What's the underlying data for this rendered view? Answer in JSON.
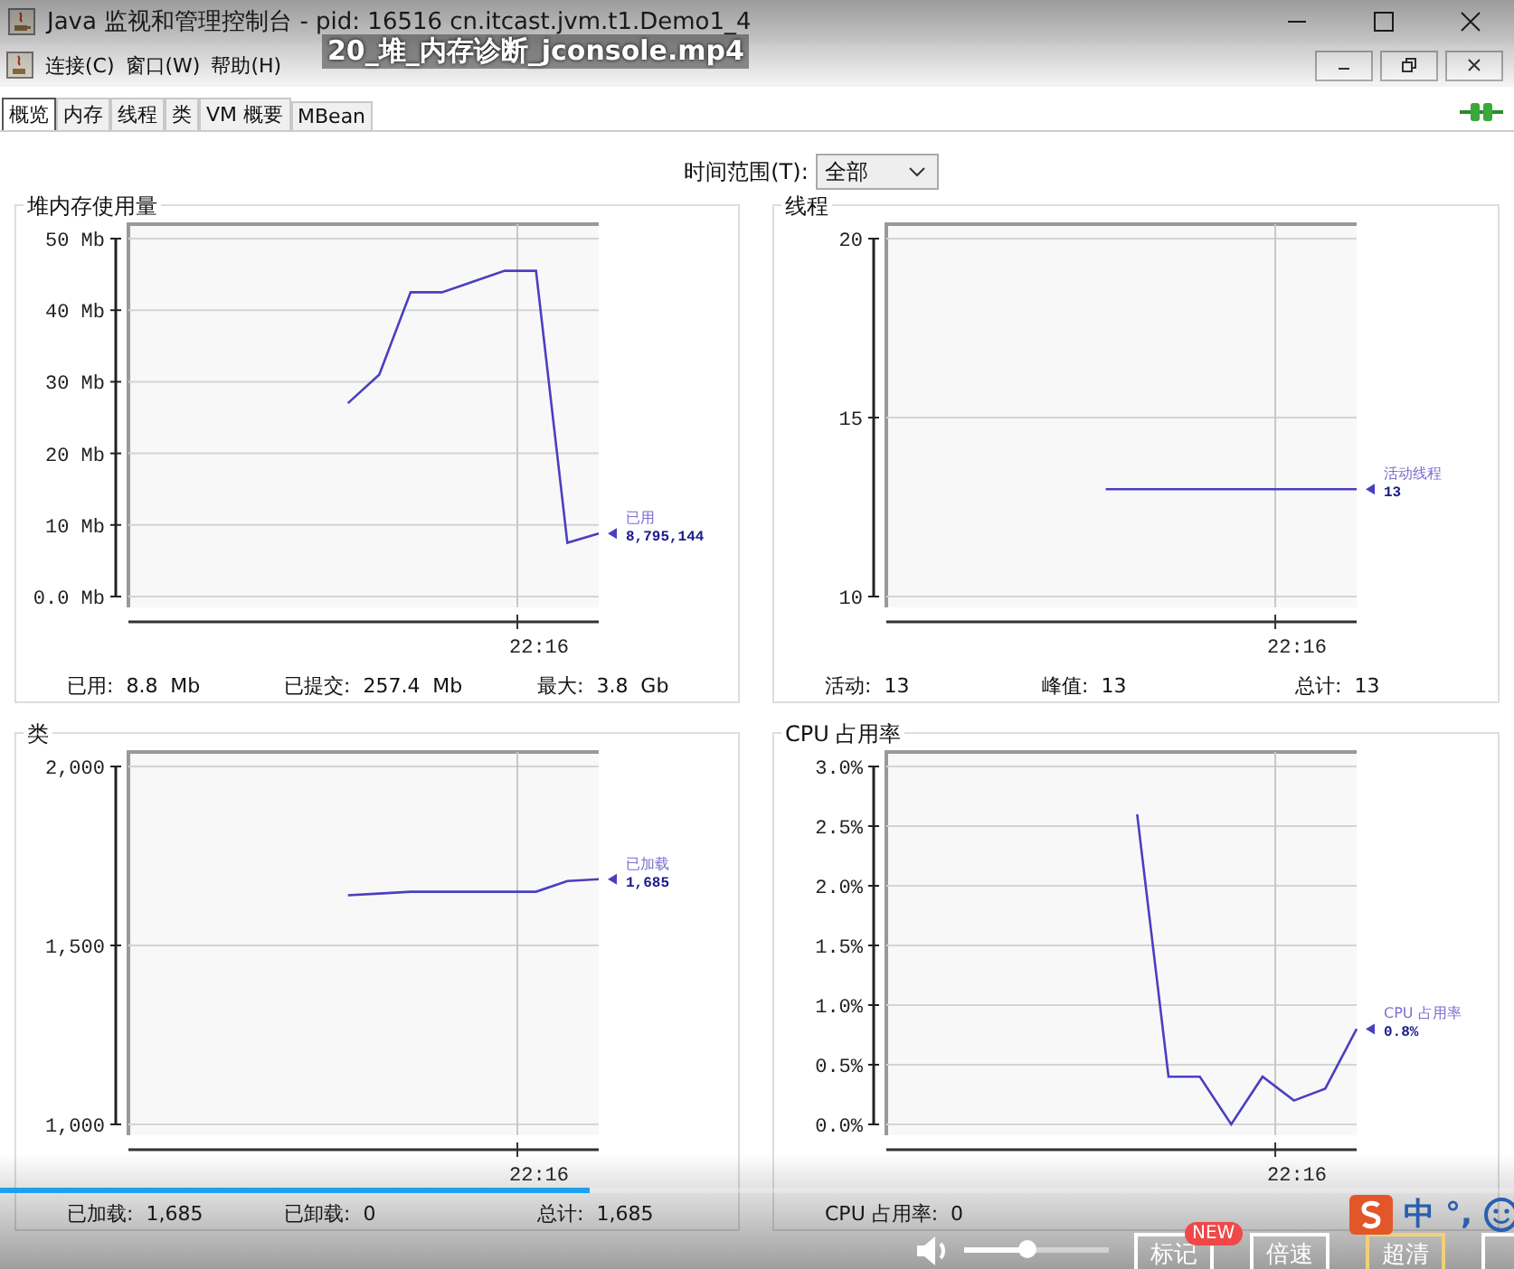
{
  "window": {
    "title": "Java 监视和管理控制台 - pid: 16516 cn.itcast.jvm.t1.Demo1_4"
  },
  "menu": [
    "连接(C)",
    "窗口(W)",
    "帮助(H)"
  ],
  "tabs": [
    {
      "label": "概览",
      "selected": true
    },
    {
      "label": "内存",
      "selected": false
    },
    {
      "label": "线程",
      "selected": false
    },
    {
      "label": "类",
      "selected": false
    },
    {
      "label": "VM 概要",
      "selected": false
    },
    {
      "label": "MBean",
      "selected": false
    }
  ],
  "time_range": {
    "label": "时间范围(T):",
    "value": "全部"
  },
  "panels": [
    {
      "title": "堆内存使用量",
      "legend_value": "8,795,144",
      "stats": [
        {
          "label": "已用:",
          "value": "8.8  Mb"
        },
        {
          "label": "已提交:",
          "value": "257.4  Mb"
        },
        {
          "label": "最大:",
          "value": "3.8  Gb"
        }
      ],
      "chart_data": {
        "type": "line",
        "categories": [
          null,
          null,
          null,
          null,
          null,
          null,
          null,
          null,
          null,
          null,
          null,
          null,
          null,
          null,
          null,
          null
        ],
        "grid": true,
        "ylim": [
          0,
          50
        ],
        "yticks": [
          {
            "value": 0,
            "label": "0.0 Mb"
          },
          {
            "value": 10,
            "label": "10 Mb"
          },
          {
            "value": 20,
            "label": "20 Mb"
          },
          {
            "value": 30,
            "label": "30 Mb"
          },
          {
            "value": 40,
            "label": "40 Mb"
          },
          {
            "value": 50,
            "label": "50 Mb"
          }
        ],
        "annotations": [
          {
            "text": "22:16"
          }
        ],
        "series": [
          {
            "name": "已用",
            "color": "#4a3fc0",
            "values": [
              null,
              null,
              null,
              null,
              null,
              null,
              null,
              27,
              31,
              42.5,
              42.5,
              44,
              45.5,
              45.5,
              7.5,
              8.8
            ]
          }
        ]
      }
    },
    {
      "title": "线程",
      "legend_value": "13",
      "stats": [
        {
          "label": "活动:",
          "value": "13"
        },
        {
          "label": "峰值:",
          "value": "13"
        },
        {
          "label": "总计:",
          "value": "13"
        }
      ],
      "chart_data": {
        "type": "line",
        "categories": [
          null,
          null,
          null,
          null,
          null,
          null,
          null,
          null,
          null,
          null,
          null,
          null,
          null,
          null,
          null,
          null
        ],
        "grid": true,
        "ylim": [
          10,
          20
        ],
        "yticks": [
          {
            "value": 10,
            "label": "10"
          },
          {
            "value": 15,
            "label": "15"
          },
          {
            "value": 20,
            "label": "20"
          }
        ],
        "annotations": [
          {
            "text": "22:16"
          }
        ],
        "series": [
          {
            "name": "活动线程",
            "color": "#4a3fc0",
            "values": [
              null,
              null,
              null,
              null,
              null,
              null,
              null,
              13,
              13,
              13,
              13,
              13,
              13,
              13,
              13,
              13
            ]
          }
        ]
      }
    },
    {
      "title": "类",
      "legend_value": "1,685",
      "stats": [
        {
          "label": "已加载:",
          "value": "1,685"
        },
        {
          "label": "已卸载:",
          "value": "0"
        },
        {
          "label": "总计:",
          "value": "1,685"
        }
      ],
      "chart_data": {
        "type": "line",
        "categories": [
          null,
          null,
          null,
          null,
          null,
          null,
          null,
          null,
          null,
          null,
          null,
          null,
          null,
          null,
          null,
          null
        ],
        "grid": true,
        "ylim": [
          1000,
          2000
        ],
        "yticks": [
          {
            "value": 1000,
            "label": "1,000"
          },
          {
            "value": 1500,
            "label": "1,500"
          },
          {
            "value": 2000,
            "label": "2,000"
          }
        ],
        "annotations": [
          {
            "text": "22:16"
          }
        ],
        "series": [
          {
            "name": "已加载",
            "color": "#4a3fc0",
            "values": [
              null,
              null,
              null,
              null,
              null,
              null,
              null,
              1640,
              1645,
              1650,
              1650,
              1650,
              1650,
              1650,
              1680,
              1685
            ]
          }
        ]
      }
    },
    {
      "title": "CPU 占用率",
      "legend_value": "0.8%",
      "stats": [
        {
          "label": "CPU 占用率:",
          "value": "0"
        }
      ],
      "chart_data": {
        "type": "line",
        "categories": [
          null,
          null,
          null,
          null,
          null,
          null,
          null,
          null,
          null,
          null,
          null,
          null,
          null,
          null,
          null,
          null
        ],
        "grid": true,
        "ylim": [
          0,
          3
        ],
        "yticks": [
          {
            "value": 0,
            "label": "0.0%"
          },
          {
            "value": 0.5,
            "label": "0.5%"
          },
          {
            "value": 1,
            "label": "1.0%"
          },
          {
            "value": 1.5,
            "label": "1.5%"
          },
          {
            "value": 2,
            "label": "2.0%"
          },
          {
            "value": 2.5,
            "label": "2.5%"
          },
          {
            "value": 3,
            "label": "3.0%"
          }
        ],
        "annotations": [
          {
            "text": "22:16"
          }
        ],
        "series": [
          {
            "name": "CPU 占用率",
            "color": "#4a3fc0",
            "values": [
              null,
              null,
              null,
              null,
              null,
              null,
              null,
              null,
              2.6,
              0.4,
              0.4,
              0,
              0.4,
              0.2,
              0.3,
              0.8
            ]
          }
        ]
      }
    }
  ],
  "video_player": {
    "title": "20_堆_内存诊断_jconsole.mp4",
    "level": 0.39,
    "volume": {
      "level": 0.44
    },
    "buttons": [
      {
        "label": "标记",
        "badge": "NEW",
        "selected": false
      },
      {
        "label": "倍速",
        "selected": false
      },
      {
        "label": "超清",
        "selected": true
      }
    ],
    "ime": {
      "label": "中",
      "punct": "°,"
    }
  }
}
